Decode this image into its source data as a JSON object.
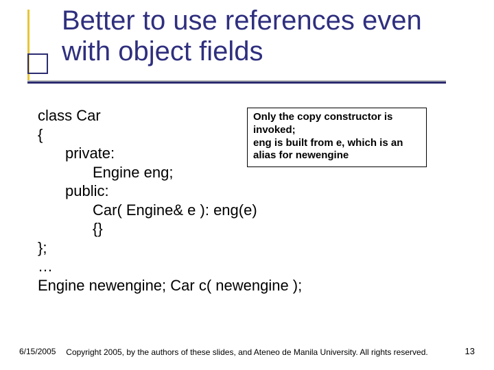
{
  "title": "Better to use references even with object fields",
  "callout": {
    "line1": "Only the copy constructor is invoked;",
    "line2": "eng is built from e, which is an alias for newengine"
  },
  "code": {
    "l1": "class Car",
    "l2": "{",
    "l3": "private:",
    "l4": "Engine eng;",
    "l5": "public:",
    "l6": "Car( Engine& e ): eng(e)",
    "l7": "{}",
    "l8": "};",
    "l9": "…",
    "l10": "Engine newengine;  Car c( newengine );"
  },
  "footer": {
    "date": "6/15/2005",
    "copyright": "Copyright 2005, by the authors of these slides, and Ateneo de Manila University. All rights reserved.",
    "page": "13"
  }
}
